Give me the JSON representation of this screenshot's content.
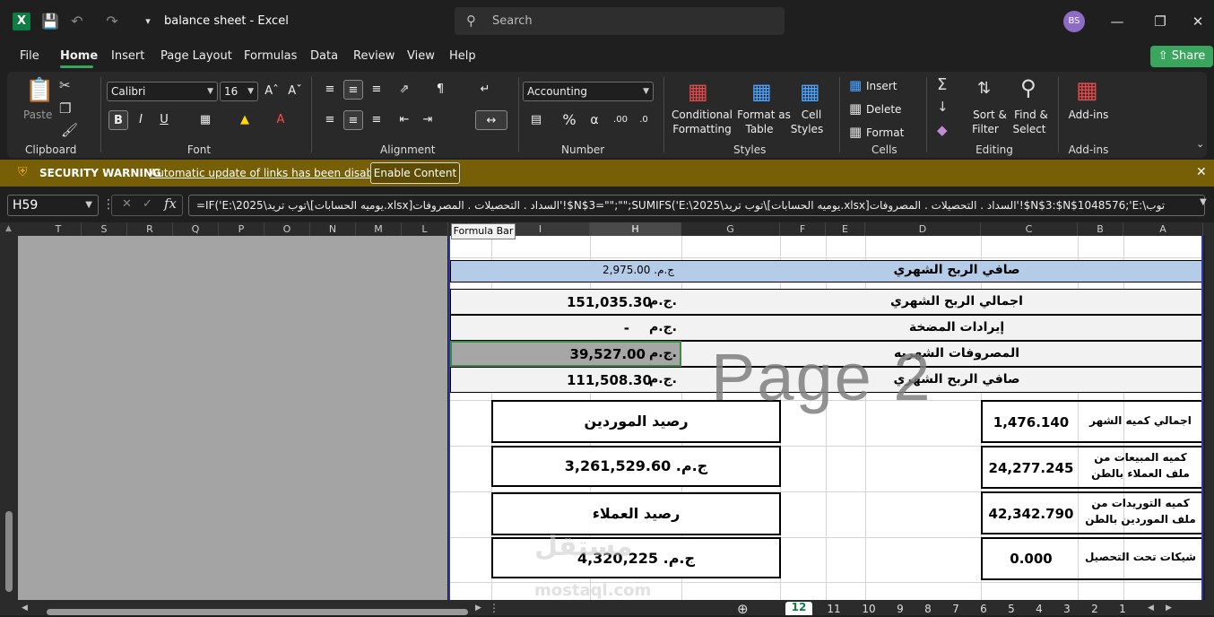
{
  "titlebar": {
    "doc_title": "balance sheet  -  Excel",
    "search_placeholder": "Search",
    "avatar": "BS"
  },
  "menu": {
    "tabs": [
      "File",
      "Home",
      "Insert",
      "Page Layout",
      "Formulas",
      "Data",
      "Review",
      "View",
      "Help"
    ],
    "share": "Share"
  },
  "ribbon": {
    "clipboard": {
      "label": "Clipboard",
      "paste": "Paste"
    },
    "font": {
      "label": "Font",
      "name": "Calibri",
      "size": "16"
    },
    "alignment": {
      "label": "Alignment"
    },
    "number": {
      "label": "Number",
      "format": "Accounting"
    },
    "styles": {
      "label": "Styles",
      "conditional": "Conditional",
      "conditional2": "Formatting",
      "format_table": "Format as",
      "format_table2": "Table",
      "cell_styles": "Cell",
      "cell_styles2": "Styles"
    },
    "cells": {
      "label": "Cells",
      "insert": "Insert",
      "delete": "Delete",
      "format": "Format"
    },
    "editing": {
      "label": "Editing",
      "sort": "Sort &",
      "sort2": "Filter",
      "find": "Find &",
      "find2": "Select"
    },
    "addins": {
      "label": "Add-ins",
      "btn": "Add-ins"
    }
  },
  "warning": {
    "title": "SECURITY WARNING",
    "message": "Automatic update of links has been disabled",
    "button": "Enable Content"
  },
  "formula_bar": {
    "name_box": "H59",
    "formula": "=IF('E:\\توب تريد\\2025\\[يوميه الحسابات.xlsx]السداد . التحصيلات . المصروفات'!$N$3=\"\";\"\";SUMIFS('E:\\توب تريد\\2025\\[يوميه الحسابات.xlsx]السداد . التحصيلات . المصروفات'!$N$3:$N$1048576;'E:\\توب",
    "tooltip": "Formula Bar"
  },
  "columns": [
    "T",
    "S",
    "R",
    "Q",
    "P",
    "O",
    "N",
    "M",
    "L",
    "I",
    "H",
    "G",
    "F",
    "E",
    "D",
    "C",
    "B",
    "A"
  ],
  "sheet": {
    "header_label": "صافي الربح الشهري",
    "header_value": "ج.م.    2,975.00",
    "rows": [
      {
        "label": "اجمالي الربح الشهري",
        "currency": "ج.م.",
        "value": "151,035.30"
      },
      {
        "label": "إيرادات المضخة",
        "currency": "ج.م.",
        "value": "-"
      },
      {
        "label": "المصروفات الشهريه",
        "currency": "ج.م.",
        "value": "39,527.00"
      },
      {
        "label": "صافي الربح الشهري",
        "currency": "ج.م.",
        "value": "111,508.30"
      }
    ],
    "suppliers_title": "رصيد الموردين",
    "suppliers_value": "ج.م.   3,261,529.60",
    "clients_title": "رصيد العملاء",
    "clients_value": "ج.م.   4,320,225",
    "qty": [
      {
        "label": "اجمالي كميه الشهر",
        "value": "1,476.140"
      },
      {
        "label": "كميه المبيعات من ملف العملاء بالطن",
        "value": "24,277.245"
      },
      {
        "label": "كميه التوريدات من ملف الموردين بالطن",
        "value": "42,342.790"
      },
      {
        "label": "شيكات تحت التحصيل",
        "value": "0.000"
      }
    ],
    "page_watermark": "Page 2",
    "mostaql_ar": "مستقل",
    "mostaql_en": "mostaql.com"
  },
  "sheet_tabs": [
    "12",
    "11",
    "10",
    "9",
    "8",
    "7",
    "6",
    "5",
    "4",
    "3",
    "2",
    "1"
  ]
}
